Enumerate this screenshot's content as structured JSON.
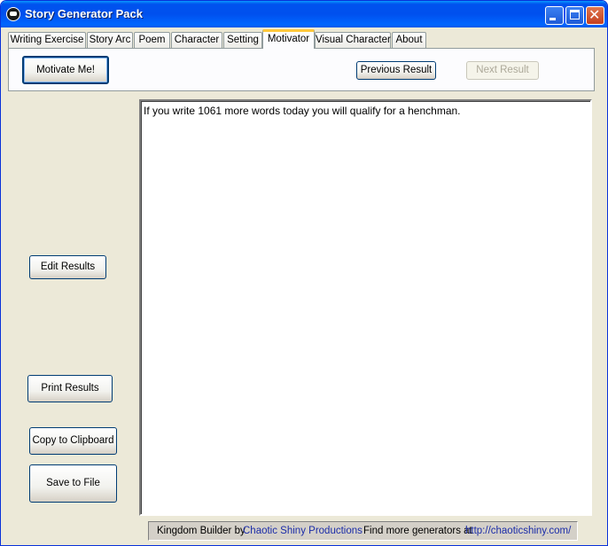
{
  "window": {
    "title": "Story Generator Pack"
  },
  "tabs": [
    {
      "label": "Writing Exercise"
    },
    {
      "label": "Story Arc"
    },
    {
      "label": "Poem"
    },
    {
      "label": "Character"
    },
    {
      "label": "Setting"
    },
    {
      "label": "Motivator"
    },
    {
      "label": "Visual Character"
    },
    {
      "label": "About"
    }
  ],
  "active_tab": "Motivator",
  "toolbar": {
    "motivate_label": "Motivate Me!",
    "previous_label": "Previous Result",
    "next_label": "Next Result"
  },
  "sidebar": {
    "edit_label": "Edit Results",
    "print_label": "Print Results",
    "copy_label": "Copy to Clipboard",
    "save_label": "Save to File"
  },
  "results": {
    "text": "If you write 1061 more words today you will qualify for a henchman."
  },
  "status": {
    "prefix": "Kingdom Builder by",
    "company_link": "Chaotic Shiny Productions",
    "more_text": "Find more generators at",
    "url_link": "http://chaoticshiny.com/"
  }
}
